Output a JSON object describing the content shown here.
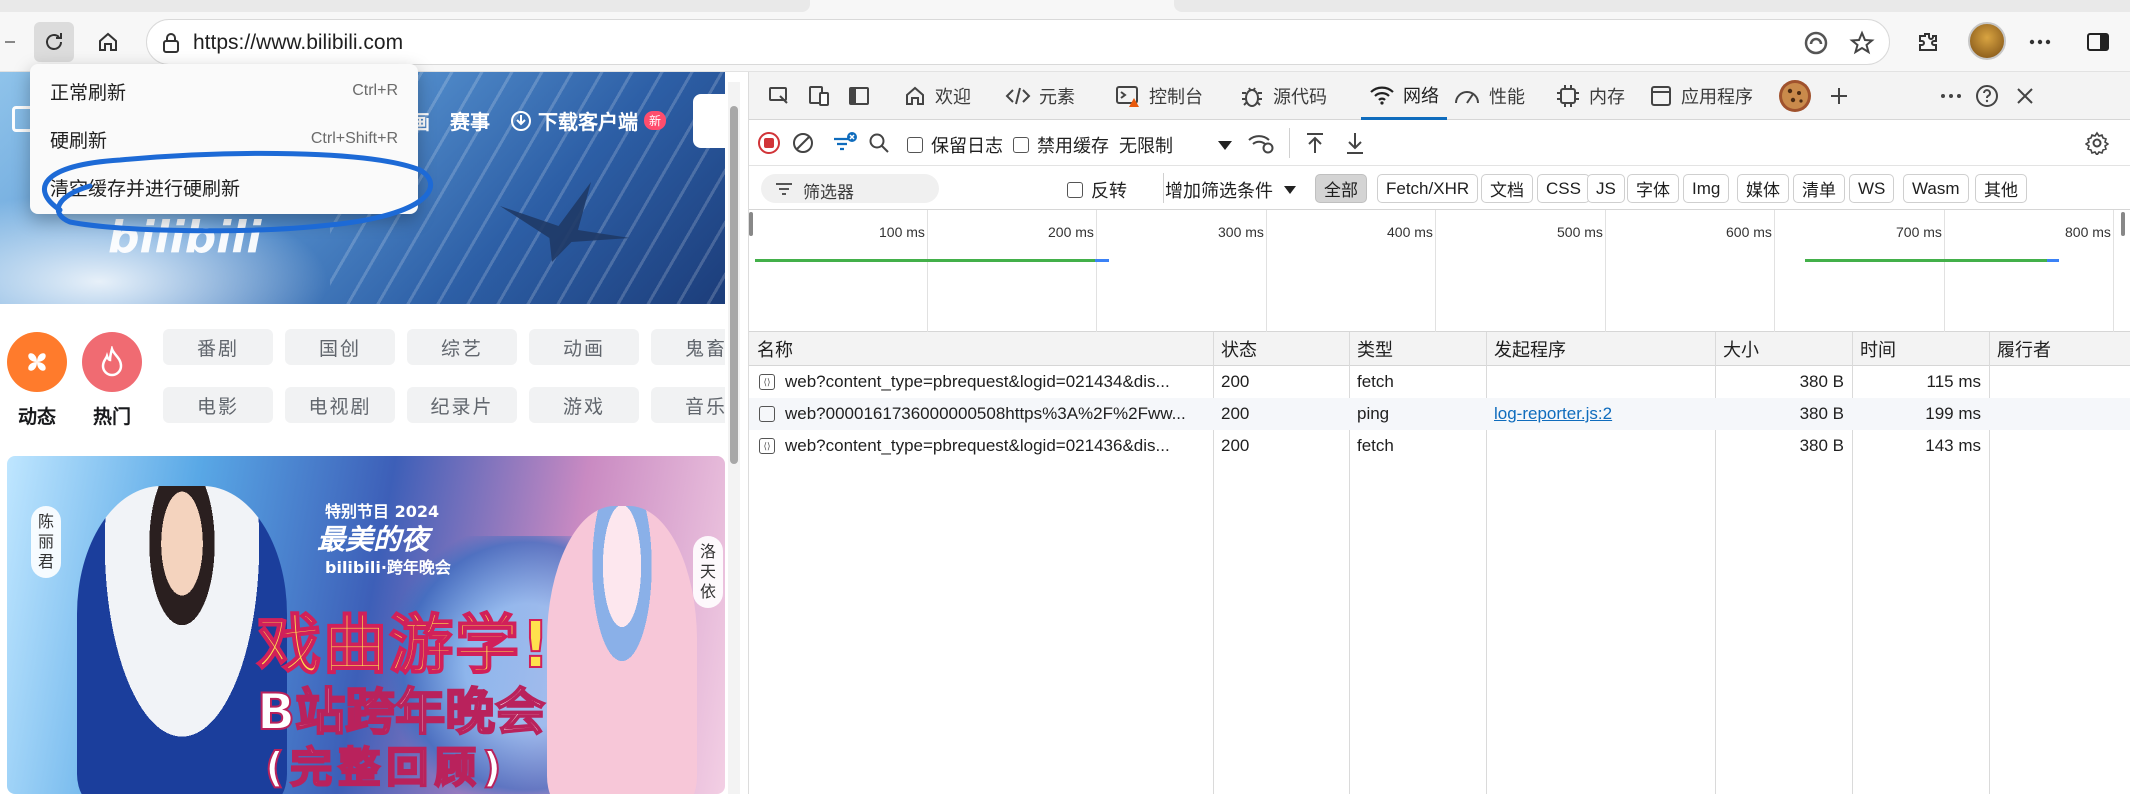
{
  "browser": {
    "url": "https://www.bilibili.com",
    "context_menu": [
      {
        "label": "正常刷新",
        "shortcut": "Ctrl+R"
      },
      {
        "label": "硬刷新",
        "shortcut": "Ctrl+Shift+R"
      },
      {
        "label": "清空缓存并进行硬刷新",
        "shortcut": ""
      }
    ]
  },
  "page": {
    "nav": [
      "画",
      "赛事",
      "下载客户端"
    ],
    "new_badge": "新",
    "quick": [
      {
        "label": "动态",
        "color": "#ff7b2c"
      },
      {
        "label": "热门",
        "color": "#f06b72"
      }
    ],
    "chips": [
      "番剧",
      "国创",
      "综艺",
      "动画",
      "鬼畜",
      "电影",
      "电视剧",
      "纪录片",
      "游戏",
      "音乐"
    ],
    "poster": {
      "tag_left": "陈丽君",
      "tag_right": "洛天依",
      "small1": "特别节目 2024",
      "small2": "最美的夜",
      "small3": "bilibili·跨年晚会",
      "title": "戏曲游学!",
      "subtitle": "B站跨年晚会",
      "subtitle2": "(完整回顾)"
    }
  },
  "devtools": {
    "tabs": [
      "欢迎",
      "元素",
      "控制台",
      "源代码",
      "网络",
      "性能",
      "内存",
      "应用程序"
    ],
    "active_tab": "网络",
    "toolbar": {
      "preserve_log": "保留日志",
      "disable_cache": "禁用缓存",
      "throttle": "无限制"
    },
    "filter": {
      "placeholder": "筛选器",
      "invert": "反转",
      "more_filters": "增加筛选条件",
      "types": [
        "全部",
        "Fetch/XHR",
        "文档",
        "CSS",
        "JS",
        "字体",
        "Img",
        "媒体",
        "清单",
        "WS",
        "Wasm",
        "其他"
      ],
      "selected": "全部"
    },
    "overview_ticks": [
      "100 ms",
      "200 ms",
      "300 ms",
      "400 ms",
      "500 ms",
      "600 ms",
      "700 ms",
      "800 ms"
    ],
    "columns": [
      "名称",
      "状态",
      "类型",
      "发起程序",
      "大小",
      "时间",
      "履行者"
    ],
    "rows": [
      {
        "name": "web?content_type=pbrequest&logid=021434&dis...",
        "status": "200",
        "type": "fetch",
        "initiator": "",
        "size": "380 B",
        "time": "115 ms",
        "fulfilled": ""
      },
      {
        "name": "web?000016173600000050​8https%3A%2F%2Fww...",
        "status": "200",
        "type": "ping",
        "initiator": "log-reporter.js:2",
        "size": "380 B",
        "time": "199 ms",
        "fulfilled": ""
      },
      {
        "name": "web?content_type=pbrequest&logid=021436&dis...",
        "status": "200",
        "type": "fetch",
        "initiator": "",
        "size": "380 B",
        "time": "143 ms",
        "fulfilled": ""
      }
    ]
  }
}
